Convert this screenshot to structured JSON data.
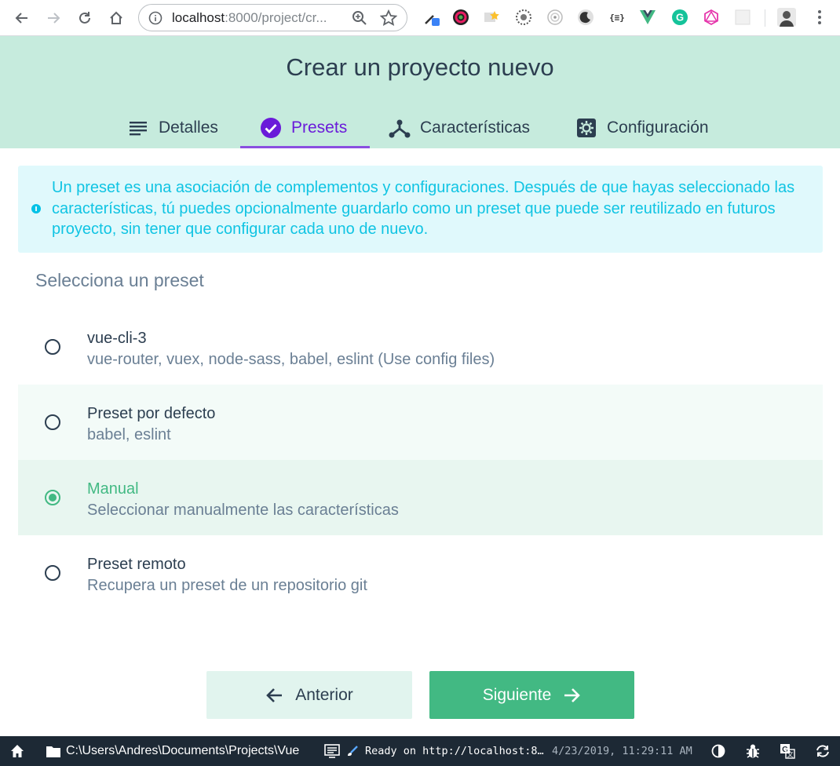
{
  "browser": {
    "url_host": "localhost",
    "url_path": ":8000/project/cr..."
  },
  "header": {
    "title": "Crear un proyecto nuevo",
    "tabs": [
      {
        "label": "Detalles",
        "icon": "list-icon"
      },
      {
        "label": "Presets",
        "icon": "check-circle-icon"
      },
      {
        "label": "Características",
        "icon": "fork-icon"
      },
      {
        "label": "Configuración",
        "icon": "gear-icon"
      }
    ],
    "active_tab": "Presets"
  },
  "info": {
    "text": "Un preset es una asociación de complementos y configuraciones. Después de que hayas seleccionado las características, tú puedes opcionalmente guardarlo como un preset que puede ser reutilizado en futuros proyecto, sin tener que configurar cada uno de nuevo."
  },
  "presets": {
    "section_title": "Selecciona un preset",
    "items": [
      {
        "name": "vue-cli-3",
        "description": "vue-router, vuex, node-sass, babel, eslint (Use config files)",
        "selected": false
      },
      {
        "name": "Preset por defecto",
        "description": "babel, eslint",
        "selected": false
      },
      {
        "name": "Manual",
        "description": "Seleccionar manualmente las características",
        "selected": true
      },
      {
        "name": "Preset remoto",
        "description": "Recupera un preset de un repositorio git",
        "selected": false
      }
    ]
  },
  "actions": {
    "prev_label": "Anterior",
    "next_label": "Siguiente"
  },
  "status_bar": {
    "path": "C:\\Users\\Andres\\Documents\\Projects\\Vue",
    "log": "Ready on http://localhost:8…",
    "timestamp": "4/23/2019, 11:29:11 AM"
  },
  "colors": {
    "header_bg": "#c6ebdd",
    "accent_purple": "#6a1bd9",
    "accent_green": "#42b983",
    "info_text": "#10c4e3",
    "status_bar_bg": "#1d2935"
  }
}
